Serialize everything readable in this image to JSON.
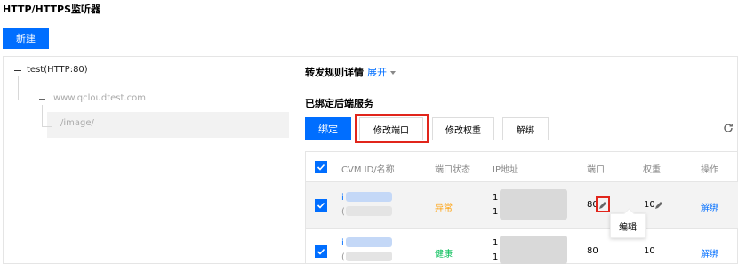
{
  "page": {
    "title": "HTTP/HTTPS监听器"
  },
  "toolbar": {
    "new_label": "新建"
  },
  "tree": {
    "root": "test(HTTP:80)",
    "domain": "www.qcloudtest.com",
    "path": "/image/"
  },
  "detail": {
    "forward_title": "转发规则详情",
    "expand_label": "展开",
    "bound_title": "已绑定后端服务",
    "buttons": {
      "bind": "绑定",
      "modify_port": "修改端口",
      "modify_weight": "修改权重",
      "unbind": "解绑"
    }
  },
  "table": {
    "headers": {
      "id_name": "CVM ID/名称",
      "port_status": "端口状态",
      "ip": "IP地址",
      "port": "端口",
      "weight": "权重",
      "action": "操作"
    },
    "rows": [
      {
        "id": "i",
        "name": "(",
        "status": "异常",
        "ip1": "1",
        "ip2": "1",
        "port": "80",
        "weight": "10",
        "action": "解绑"
      },
      {
        "id": "i",
        "name": "(",
        "status": "健康",
        "ip1": "1",
        "ip2": "1",
        "port": "80",
        "weight": "10",
        "action": "解绑"
      }
    ]
  },
  "tooltip": {
    "text": "编辑"
  },
  "colors": {
    "primary": "#006eff",
    "highlight": "#e1251b",
    "abnormal": "#ff9d00",
    "healthy": "#0abf5b"
  },
  "icons": [
    "refresh-icon",
    "pencil-icon",
    "check-icon",
    "caret-down-icon"
  ]
}
